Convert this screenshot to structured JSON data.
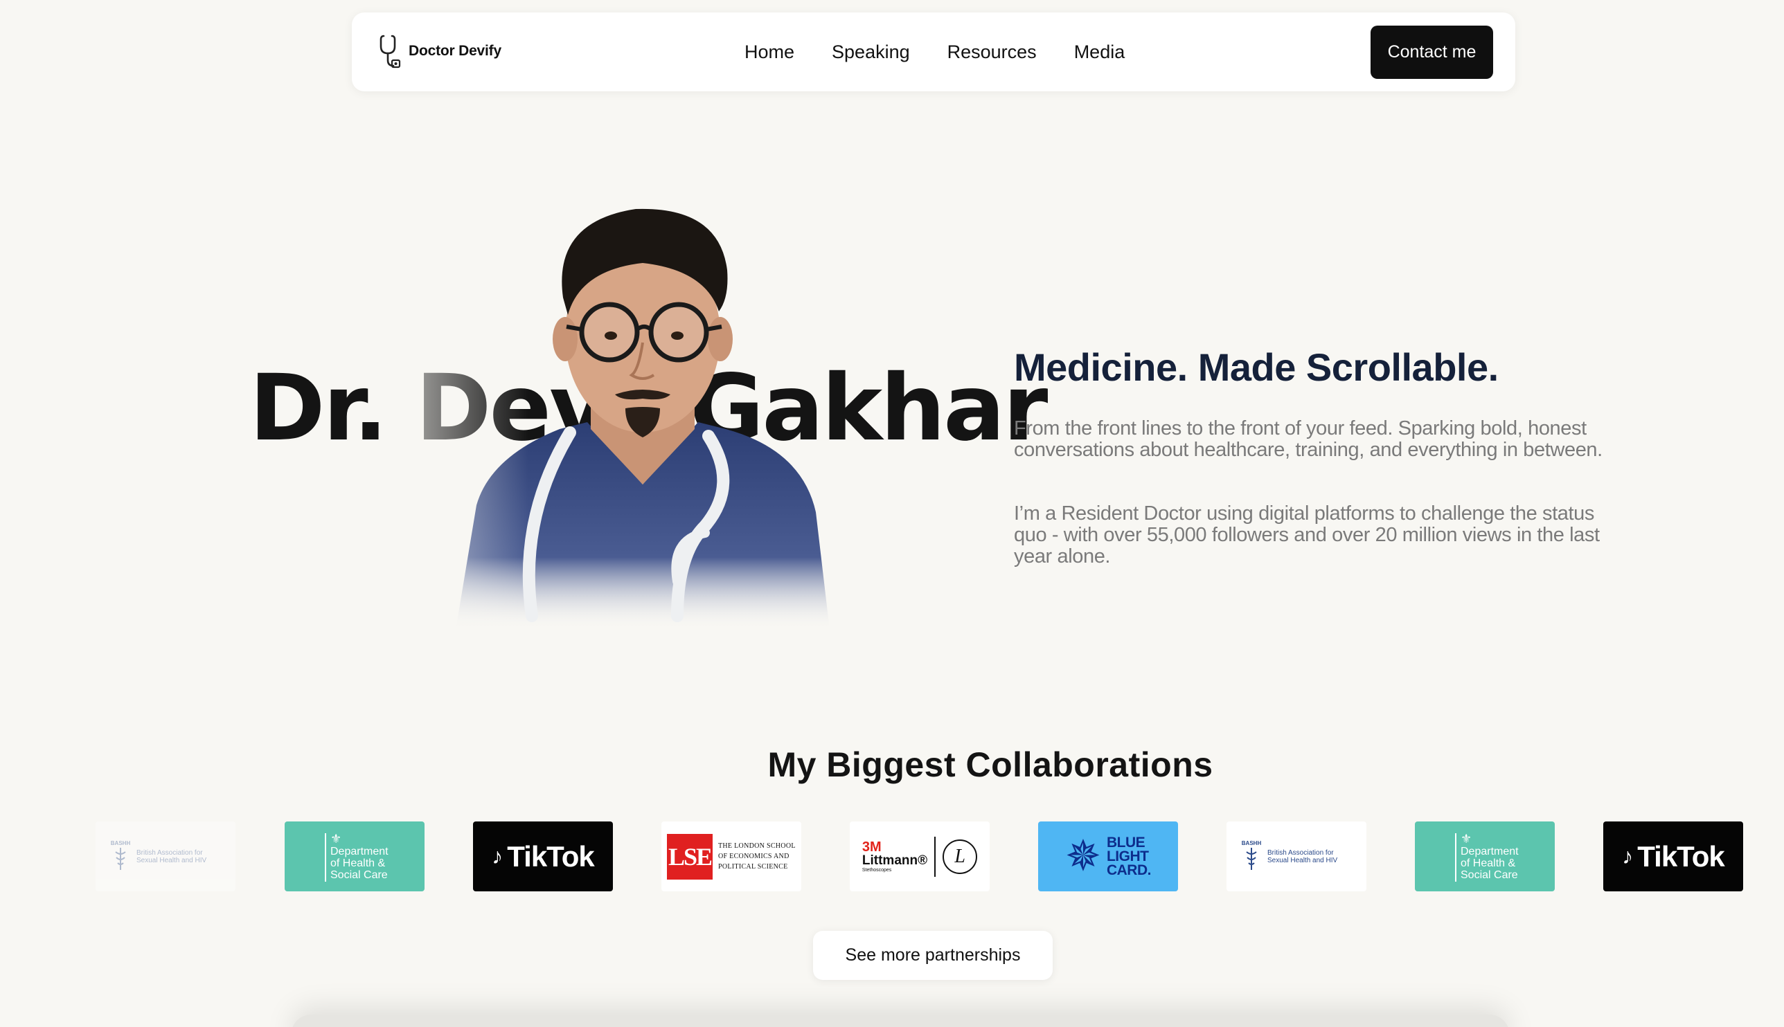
{
  "nav": {
    "brand": "Doctor Devify",
    "links": [
      "Home",
      "Speaking",
      "Resources",
      "Media"
    ],
    "cta": "Contact me"
  },
  "hero": {
    "name_first": "Dr. Dev",
    "name_last": "Gakhar",
    "tagline": "Medicine. Made Scrollable.",
    "para1": "From the front lines to the front of your feed. Sparking bold, honest conversations about healthcare, training, and everything in between.",
    "para2": "I’m a Resident Doctor using digital platforms to challenge the status quo - with over 55,000 followers and over 20 million views in the last year alone."
  },
  "collaborations": {
    "title": "My Biggest Collaborations",
    "logos": {
      "bashh_acronym": "BASHH",
      "bashh": "British Association for Sexual Health and HIV",
      "dhsc": [
        "Department",
        "of Health &",
        "Social Care"
      ],
      "tiktok": "TikTok",
      "lse_mark": "LSE",
      "lse": [
        "THE LONDON SCHOOL",
        "OF ECONOMICS AND",
        "POLITICAL SCIENCE"
      ],
      "littmann_brand": "3M",
      "littmann": "Littmann®",
      "littmann_sub": "Stethoscopes",
      "littmann_seal": "L",
      "blc": [
        "BLUE",
        "LIGHT",
        "CARD."
      ]
    },
    "see_more": "See more partnerships"
  },
  "colors": {
    "background": "#f8f7f3",
    "dhsc_teal": "#5cc5ae",
    "blc_blue": "#4fb6f3",
    "lse_red": "#e02020",
    "tagline_navy": "#15213a"
  }
}
